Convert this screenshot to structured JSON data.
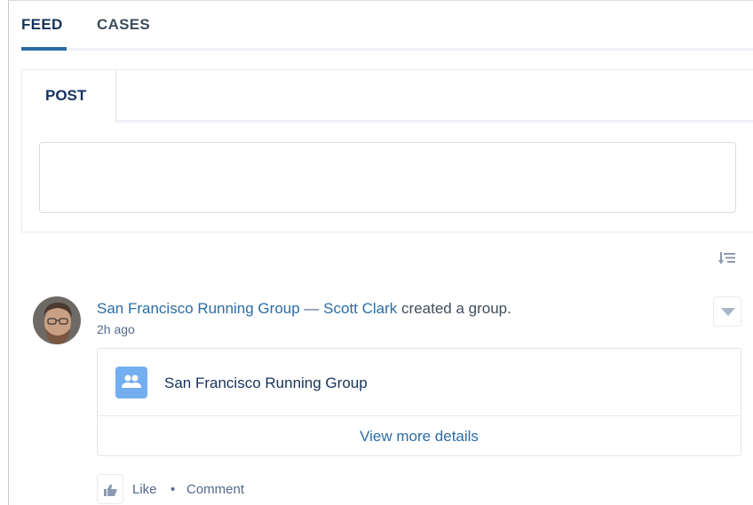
{
  "tabs": [
    {
      "label": "FEED",
      "active": true
    },
    {
      "label": "CASES",
      "active": false
    }
  ],
  "publisher": {
    "tab_label": "POST",
    "input_value": ""
  },
  "icons": {
    "sort": "sort-icon",
    "avatar": "user-avatar",
    "menu": "chevron-down-icon",
    "group": "group-icon",
    "like": "thumbs-up-icon"
  },
  "feed_item": {
    "group_link": "San Francisco Running Group",
    "separator": "—",
    "user_link": "Scott Clark",
    "action_text": "created a group.",
    "timestamp": "2h ago",
    "attachment": {
      "name": "San Francisco Running Group",
      "view_more": "View more details"
    },
    "actions": {
      "like": "Like",
      "dot": "•",
      "comment": "Comment"
    }
  },
  "colors": {
    "accent": "#2b6da6",
    "text": "#16325c",
    "group_icon_bg": "#73aef0"
  }
}
